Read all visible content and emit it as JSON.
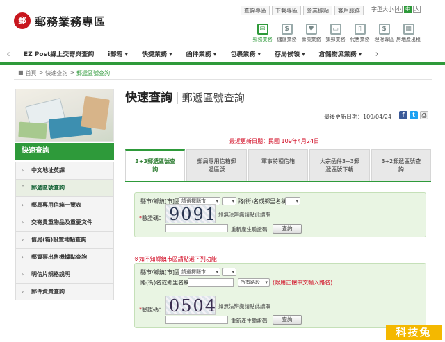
{
  "brand": {
    "logo_text": "郵務業務專區",
    "logo_mark": "郵"
  },
  "top_links": [
    "查詢專區",
    "下載專區",
    "營業據點",
    "客戶服務"
  ],
  "font_size": {
    "label": "字型大小",
    "small": "小",
    "medium": "中",
    "large": "大"
  },
  "services": [
    {
      "label": "郵務業務",
      "glyph": "✉"
    },
    {
      "label": "儲匯業務",
      "glyph": "$"
    },
    {
      "label": "壽險業務",
      "glyph": "♥"
    },
    {
      "label": "集郵業務",
      "glyph": "▭"
    },
    {
      "label": "代售業務",
      "glyph": "▯"
    },
    {
      "label": "理財專區",
      "glyph": "$"
    },
    {
      "label": "房地產出租",
      "glyph": "▦"
    }
  ],
  "nav": {
    "left_arrow": "‹",
    "right_arrow": "›",
    "items": [
      "EZ Post線上交寄與查詢",
      "i郵箱 ▾",
      "快捷業務 ▾",
      "函件業務 ▾",
      "包裹業務 ▾",
      "存局候領 ▾",
      "倉儲物流業務 ▾"
    ]
  },
  "breadcrumb": {
    "home": "首頁",
    "sep": ">",
    "level1": "快速查詢",
    "current": "郵遞區號查詢"
  },
  "sidebar": {
    "title": "快速查詢",
    "items": [
      "中文地址英譯",
      "郵遞區號查詢",
      "郵局專用信箱一覽表",
      "交寄貴重物品及重要文件",
      "信局(箱)設置地點查詢",
      "郵資票出售機據點查詢",
      "明信片規格說明",
      "郵件資費查詢"
    ]
  },
  "main": {
    "title": "快速查詢",
    "title_sep": "|",
    "subtitle": "郵遞區號查詢",
    "last_update": "最後更新日期：109/04/24",
    "share": {
      "facebook": "f",
      "twitter": "t",
      "print": "⎙"
    },
    "new_date": "最近更新日期：民國 109年4月24日",
    "tabs": [
      {
        "l1": "3+3郵遞區號查",
        "l2": "詢"
      },
      {
        "l1": "郵局專用信箱郵",
        "l2": "遞區號"
      },
      {
        "l1": "軍事特種信箱",
        "l2": ""
      },
      {
        "l1": "大宗函件3+3郵",
        "l2": "遞區號下載"
      },
      {
        "l1": "3+2郵遞區號查",
        "l2": "詢"
      }
    ]
  },
  "form1": {
    "county_label": "縣市/鄉鎮[市]區",
    "county_select": "請選擇縣市",
    "road_label": "路(街)名或鄉里名稱",
    "captcha_label": "驗證碼：",
    "captcha_code": "9091",
    "captcha_hint": "如無法辨識請點此讀取",
    "refresh_label": "重新產生驗證碼",
    "search_button": "查詢"
  },
  "note": "如不知鄉鎮市區請點選下列功能",
  "form2": {
    "county_label": "縣市/鄉鎮[市]區",
    "county_select": "請選擇縣市",
    "road_label": "路(街)名或鄉里名稱",
    "road_select": "所有路段",
    "road_hint": "(限用正體中文輸入路名)",
    "captcha_label": "驗證碼：",
    "captcha_code": "0504",
    "captcha_hint": "如無法辨識請點此讀取",
    "refresh_label": "重新產生驗證碼",
    "search_button": "查詢"
  },
  "watermark": "科技兔"
}
